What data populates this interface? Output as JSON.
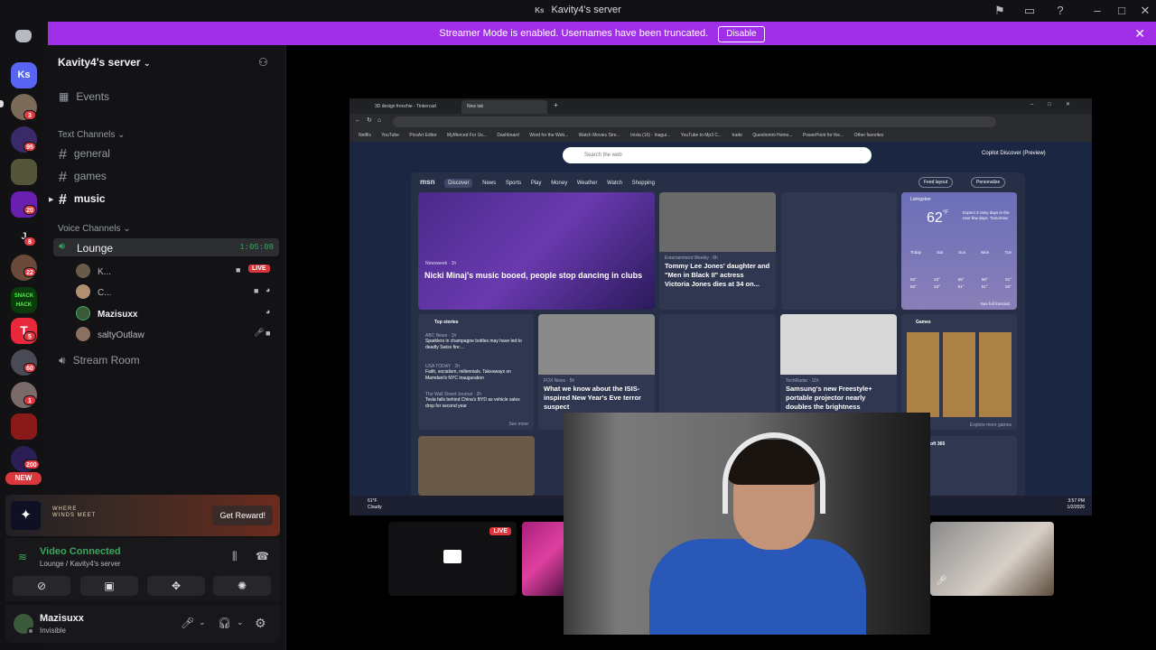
{
  "window": {
    "initials": "Ks",
    "title": "Kavity4's server"
  },
  "banner": {
    "text": "Streamer Mode is enabled. Usernames have been truncated.",
    "button": "Disable"
  },
  "servers": {
    "home_initials": "Ks",
    "badges": [
      "3",
      "95",
      "20",
      "8",
      "22",
      "5",
      "60",
      "1",
      "200"
    ],
    "dm_initial": "J",
    "new_label": "NEW"
  },
  "sidebar": {
    "server_name": "Kavity4's server",
    "events": "Events",
    "text_category": "Text Channels",
    "text_channels": [
      "general",
      "games",
      "music"
    ],
    "voice_category": "Voice Channels",
    "voice_channels": {
      "lounge": "Lounge",
      "lounge_timer": "1:05:08",
      "stream_room": "Stream Room"
    },
    "voice_users": [
      "K...",
      "C...",
      "Mazisuxx",
      "saltyOutlaw"
    ],
    "live_label": "LIVE"
  },
  "promo": {
    "logo_text": "WHERE WINDS MEET",
    "button": "Get Reward!"
  },
  "voice": {
    "status": "Video Connected",
    "location": "Lounge / Kavity4's server"
  },
  "user": {
    "name": "Mazisuxx",
    "status": "Invisible"
  },
  "browser": {
    "tabs": [
      "3D design frenchie - Tinkercad",
      "New tab"
    ],
    "bookmarks": [
      "Netflix",
      "YouTube",
      "PicsArt Editor",
      "MyMerced For Us...",
      "Dashboard",
      "Word for the Web...",
      "Watch Movies Stre...",
      "Inixia (16) - Inagui...",
      "YouTube to Mp3 C...",
      "trade",
      "Questionmi Home...",
      "PowerPoint for the...",
      "Other favorites"
    ],
    "search_placeholder": "Search the web",
    "copilot": "Copilot Discover (Preview)",
    "msn_logo": "msn",
    "nav": [
      "Discover",
      "News",
      "Sports",
      "Play",
      "Money",
      "Weather",
      "Watch",
      "Shopping"
    ],
    "feed_layout": "Feed layout",
    "personalize": "Personalize",
    "cards": {
      "nicki": {
        "source": "Newsweek · 1h",
        "title": "Nicki Minaj's music booed, people stop dancing in clubs"
      },
      "tommy": {
        "source": "Entertainment Weekly · 6h",
        "title": "Tommy Lee Jones' daughter and \"Men in Black II\" actress Victoria Jones dies at 34 on..."
      },
      "weather": {
        "location": "Livingston",
        "temp": "62",
        "unit": "°F",
        "note": "Expect 3 rainy days in the next few days. Tomorrow.",
        "days": [
          "Today",
          "Sat",
          "Sun",
          "Mon",
          "Tue"
        ],
        "highs": [
          "55°",
          "63°",
          "55°",
          "58°",
          "61°"
        ],
        "lows": [
          "55°",
          "53°",
          "51°",
          "51°",
          "50°"
        ],
        "forecast": "See full forecast"
      },
      "top_stories": {
        "heading": "Top stories",
        "items": [
          {
            "source": "ABC News · 1h",
            "title": "Sparklers in champagne bottles may have led to deadly Swiss fire:..."
          },
          {
            "source": "USA TODAY · 2h",
            "title": "Faith, socialism, millennials. Takeaways on Mamdani's NYC inauguration"
          },
          {
            "source": "The Wall Street Journal · 2h",
            "title": "Tesla falls behind China's BYD as vehicle sales drop for second year"
          }
        ],
        "see_more": "See more"
      },
      "isis": {
        "source": "FOX News · 5h",
        "title": "What we know about the ISIS-inspired New Year's Eve terror suspect"
      },
      "samsung": {
        "source": "TechRadar · 11h",
        "title": "Samsung's new Freestyle+ portable projector nearly doubles the brightness"
      },
      "games": {
        "heading": "Games",
        "explore": "Explore more games"
      },
      "m365": {
        "heading": "Microsoft 365"
      }
    },
    "taskbar": {
      "temp": "61°F",
      "weather": "Cloudy",
      "time": "3:57 PM",
      "date": "1/2/2026"
    }
  },
  "tiles": {
    "live_label": "LIVE"
  }
}
